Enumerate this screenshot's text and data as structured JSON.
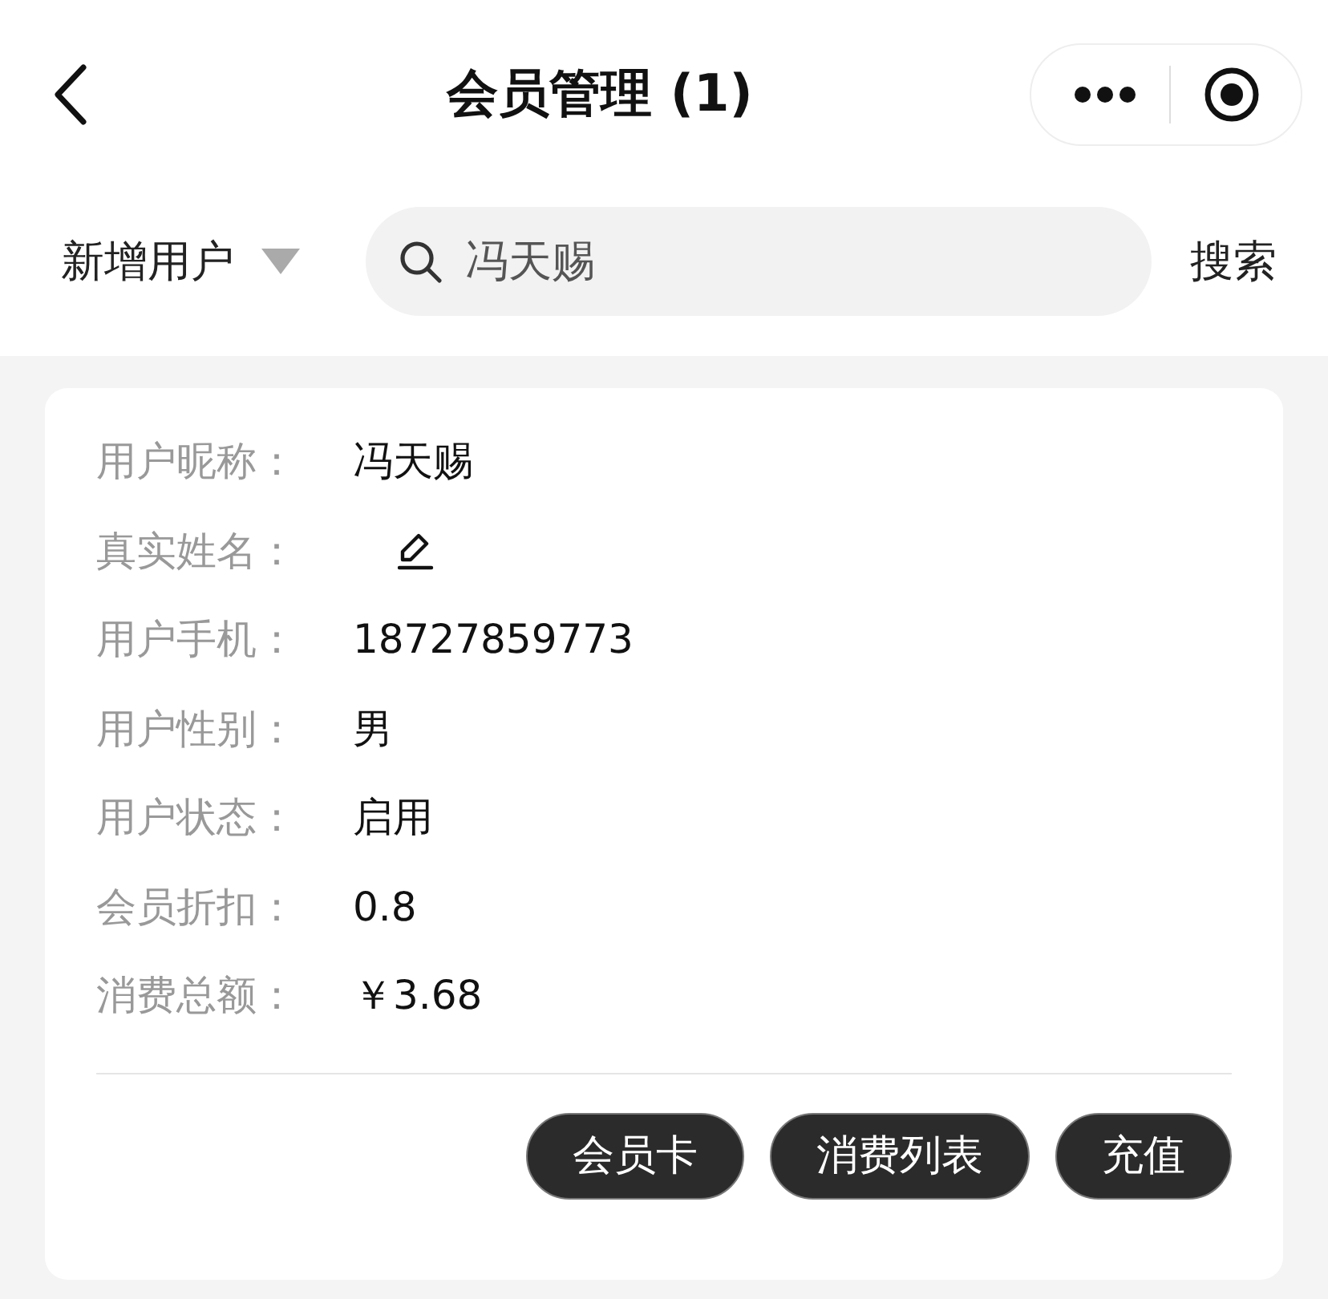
{
  "header": {
    "title": "会员管理 (1)"
  },
  "filter": {
    "label": "新增用户"
  },
  "search": {
    "value": "冯天赐",
    "button": "搜索"
  },
  "member": {
    "fields": [
      {
        "kind": "text",
        "label": "用户昵称：",
        "value": "冯天赐"
      },
      {
        "kind": "editable",
        "label": "真实姓名："
      },
      {
        "kind": "text",
        "label": "用户手机：",
        "value": "18727859773"
      },
      {
        "kind": "text",
        "label": "用户性别：",
        "value": "男"
      },
      {
        "kind": "text",
        "label": "用户状态：",
        "value": "启用"
      },
      {
        "kind": "text",
        "label": "会员折扣：",
        "value": "0.8"
      },
      {
        "kind": "text",
        "label": "消费总额：",
        "value": "￥3.68"
      }
    ],
    "actions": [
      "会员卡",
      "消费列表",
      "充值"
    ]
  }
}
